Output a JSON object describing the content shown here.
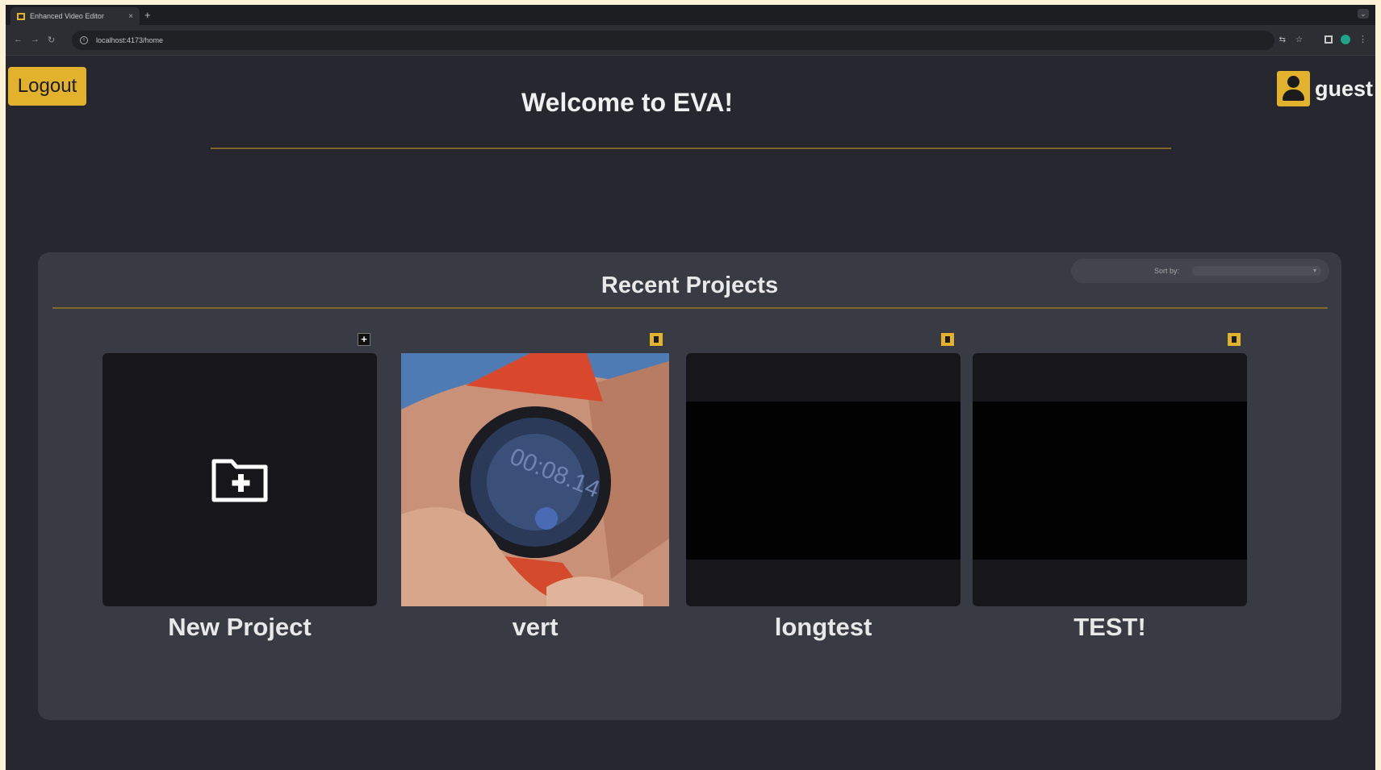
{
  "browser": {
    "tab_title": "Enhanced Video Editor",
    "tab_close": "×",
    "new_tab": "+",
    "url": "localhost:4173/home"
  },
  "header": {
    "logout_label": "Logout",
    "welcome": "Welcome to EVA!",
    "username": "guest"
  },
  "projects": {
    "title": "Recent Projects",
    "sort_label": "Sort by:",
    "sort_value": "",
    "items": [
      {
        "name": "New Project",
        "type": "new",
        "icon": "folder-plus-icon"
      },
      {
        "name": "vert",
        "type": "video",
        "thumbnail": "smartwatch-photo"
      },
      {
        "name": "longtest",
        "type": "video",
        "thumbnail": "black"
      },
      {
        "name": "TEST!",
        "type": "video",
        "thumbnail": "black"
      }
    ]
  },
  "colors": {
    "accent": "#e3b22c",
    "background": "#26272f",
    "panel": "#383a44",
    "thumbnail": "#17171b"
  }
}
